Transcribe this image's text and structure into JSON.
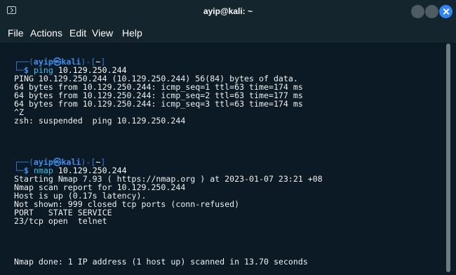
{
  "window": {
    "title": "ayip@kali: ~",
    "icon": "terminal-icon"
  },
  "menu": [
    "File",
    "Actions",
    "Edit",
    "View",
    "Help"
  ],
  "prompt": {
    "user": "ayip",
    "at": "㉿",
    "host": "kali",
    "dir": "~",
    "symbol": "$"
  },
  "blocks": [
    {
      "command_name": "ping",
      "command_arg": "10.129.250.244",
      "output": [
        "PING 10.129.250.244 (10.129.250.244) 56(84) bytes of data.",
        "64 bytes from 10.129.250.244: icmp_seq=1 ttl=63 time=174 ms",
        "64 bytes from 10.129.250.244: icmp_seq=2 ttl=63 time=177 ms",
        "64 bytes from 10.129.250.244: icmp_seq=3 ttl=63 time=174 ms",
        "^Z",
        "zsh: suspended  ping 10.129.250.244"
      ]
    },
    {
      "command_name": "nmap",
      "command_arg": "10.129.250.244",
      "output": [
        "Starting Nmap 7.93 ( https://nmap.org ) at 2023-01-07 23:21 +08",
        "Nmap scan report for 10.129.250.244",
        "Host is up (0.17s latency).",
        "Not shown: 999 closed tcp ports (conn-refused)",
        "PORT   STATE SERVICE",
        "23/tcp open  telnet",
        "",
        "Nmap done: 1 IP address (1 host up) scanned in 13.70 seconds"
      ]
    }
  ]
}
